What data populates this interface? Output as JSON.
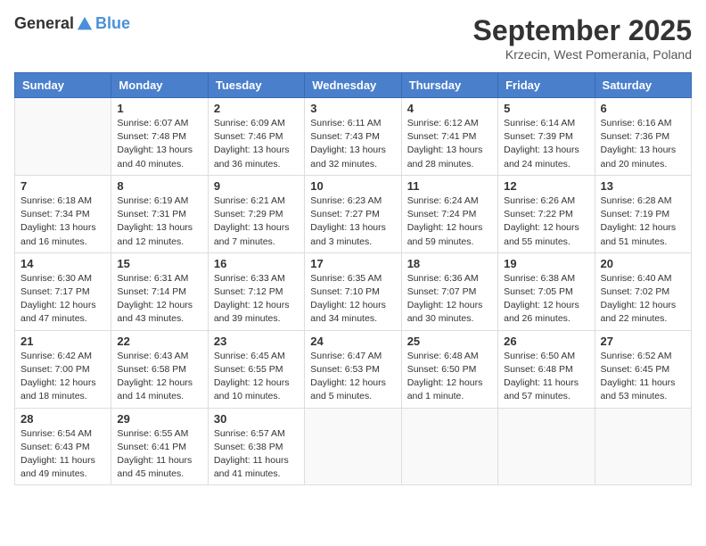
{
  "header": {
    "logo_general": "General",
    "logo_blue": "Blue",
    "month": "September 2025",
    "location": "Krzecin, West Pomerania, Poland"
  },
  "days_of_week": [
    "Sunday",
    "Monday",
    "Tuesday",
    "Wednesday",
    "Thursday",
    "Friday",
    "Saturday"
  ],
  "weeks": [
    [
      {
        "day": "",
        "info": ""
      },
      {
        "day": "1",
        "info": "Sunrise: 6:07 AM\nSunset: 7:48 PM\nDaylight: 13 hours\nand 40 minutes."
      },
      {
        "day": "2",
        "info": "Sunrise: 6:09 AM\nSunset: 7:46 PM\nDaylight: 13 hours\nand 36 minutes."
      },
      {
        "day": "3",
        "info": "Sunrise: 6:11 AM\nSunset: 7:43 PM\nDaylight: 13 hours\nand 32 minutes."
      },
      {
        "day": "4",
        "info": "Sunrise: 6:12 AM\nSunset: 7:41 PM\nDaylight: 13 hours\nand 28 minutes."
      },
      {
        "day": "5",
        "info": "Sunrise: 6:14 AM\nSunset: 7:39 PM\nDaylight: 13 hours\nand 24 minutes."
      },
      {
        "day": "6",
        "info": "Sunrise: 6:16 AM\nSunset: 7:36 PM\nDaylight: 13 hours\nand 20 minutes."
      }
    ],
    [
      {
        "day": "7",
        "info": "Sunrise: 6:18 AM\nSunset: 7:34 PM\nDaylight: 13 hours\nand 16 minutes."
      },
      {
        "day": "8",
        "info": "Sunrise: 6:19 AM\nSunset: 7:31 PM\nDaylight: 13 hours\nand 12 minutes."
      },
      {
        "day": "9",
        "info": "Sunrise: 6:21 AM\nSunset: 7:29 PM\nDaylight: 13 hours\nand 7 minutes."
      },
      {
        "day": "10",
        "info": "Sunrise: 6:23 AM\nSunset: 7:27 PM\nDaylight: 13 hours\nand 3 minutes."
      },
      {
        "day": "11",
        "info": "Sunrise: 6:24 AM\nSunset: 7:24 PM\nDaylight: 12 hours\nand 59 minutes."
      },
      {
        "day": "12",
        "info": "Sunrise: 6:26 AM\nSunset: 7:22 PM\nDaylight: 12 hours\nand 55 minutes."
      },
      {
        "day": "13",
        "info": "Sunrise: 6:28 AM\nSunset: 7:19 PM\nDaylight: 12 hours\nand 51 minutes."
      }
    ],
    [
      {
        "day": "14",
        "info": "Sunrise: 6:30 AM\nSunset: 7:17 PM\nDaylight: 12 hours\nand 47 minutes."
      },
      {
        "day": "15",
        "info": "Sunrise: 6:31 AM\nSunset: 7:14 PM\nDaylight: 12 hours\nand 43 minutes."
      },
      {
        "day": "16",
        "info": "Sunrise: 6:33 AM\nSunset: 7:12 PM\nDaylight: 12 hours\nand 39 minutes."
      },
      {
        "day": "17",
        "info": "Sunrise: 6:35 AM\nSunset: 7:10 PM\nDaylight: 12 hours\nand 34 minutes."
      },
      {
        "day": "18",
        "info": "Sunrise: 6:36 AM\nSunset: 7:07 PM\nDaylight: 12 hours\nand 30 minutes."
      },
      {
        "day": "19",
        "info": "Sunrise: 6:38 AM\nSunset: 7:05 PM\nDaylight: 12 hours\nand 26 minutes."
      },
      {
        "day": "20",
        "info": "Sunrise: 6:40 AM\nSunset: 7:02 PM\nDaylight: 12 hours\nand 22 minutes."
      }
    ],
    [
      {
        "day": "21",
        "info": "Sunrise: 6:42 AM\nSunset: 7:00 PM\nDaylight: 12 hours\nand 18 minutes."
      },
      {
        "day": "22",
        "info": "Sunrise: 6:43 AM\nSunset: 6:58 PM\nDaylight: 12 hours\nand 14 minutes."
      },
      {
        "day": "23",
        "info": "Sunrise: 6:45 AM\nSunset: 6:55 PM\nDaylight: 12 hours\nand 10 minutes."
      },
      {
        "day": "24",
        "info": "Sunrise: 6:47 AM\nSunset: 6:53 PM\nDaylight: 12 hours\nand 5 minutes."
      },
      {
        "day": "25",
        "info": "Sunrise: 6:48 AM\nSunset: 6:50 PM\nDaylight: 12 hours\nand 1 minute."
      },
      {
        "day": "26",
        "info": "Sunrise: 6:50 AM\nSunset: 6:48 PM\nDaylight: 11 hours\nand 57 minutes."
      },
      {
        "day": "27",
        "info": "Sunrise: 6:52 AM\nSunset: 6:45 PM\nDaylight: 11 hours\nand 53 minutes."
      }
    ],
    [
      {
        "day": "28",
        "info": "Sunrise: 6:54 AM\nSunset: 6:43 PM\nDaylight: 11 hours\nand 49 minutes."
      },
      {
        "day": "29",
        "info": "Sunrise: 6:55 AM\nSunset: 6:41 PM\nDaylight: 11 hours\nand 45 minutes."
      },
      {
        "day": "30",
        "info": "Sunrise: 6:57 AM\nSunset: 6:38 PM\nDaylight: 11 hours\nand 41 minutes."
      },
      {
        "day": "",
        "info": ""
      },
      {
        "day": "",
        "info": ""
      },
      {
        "day": "",
        "info": ""
      },
      {
        "day": "",
        "info": ""
      }
    ]
  ]
}
